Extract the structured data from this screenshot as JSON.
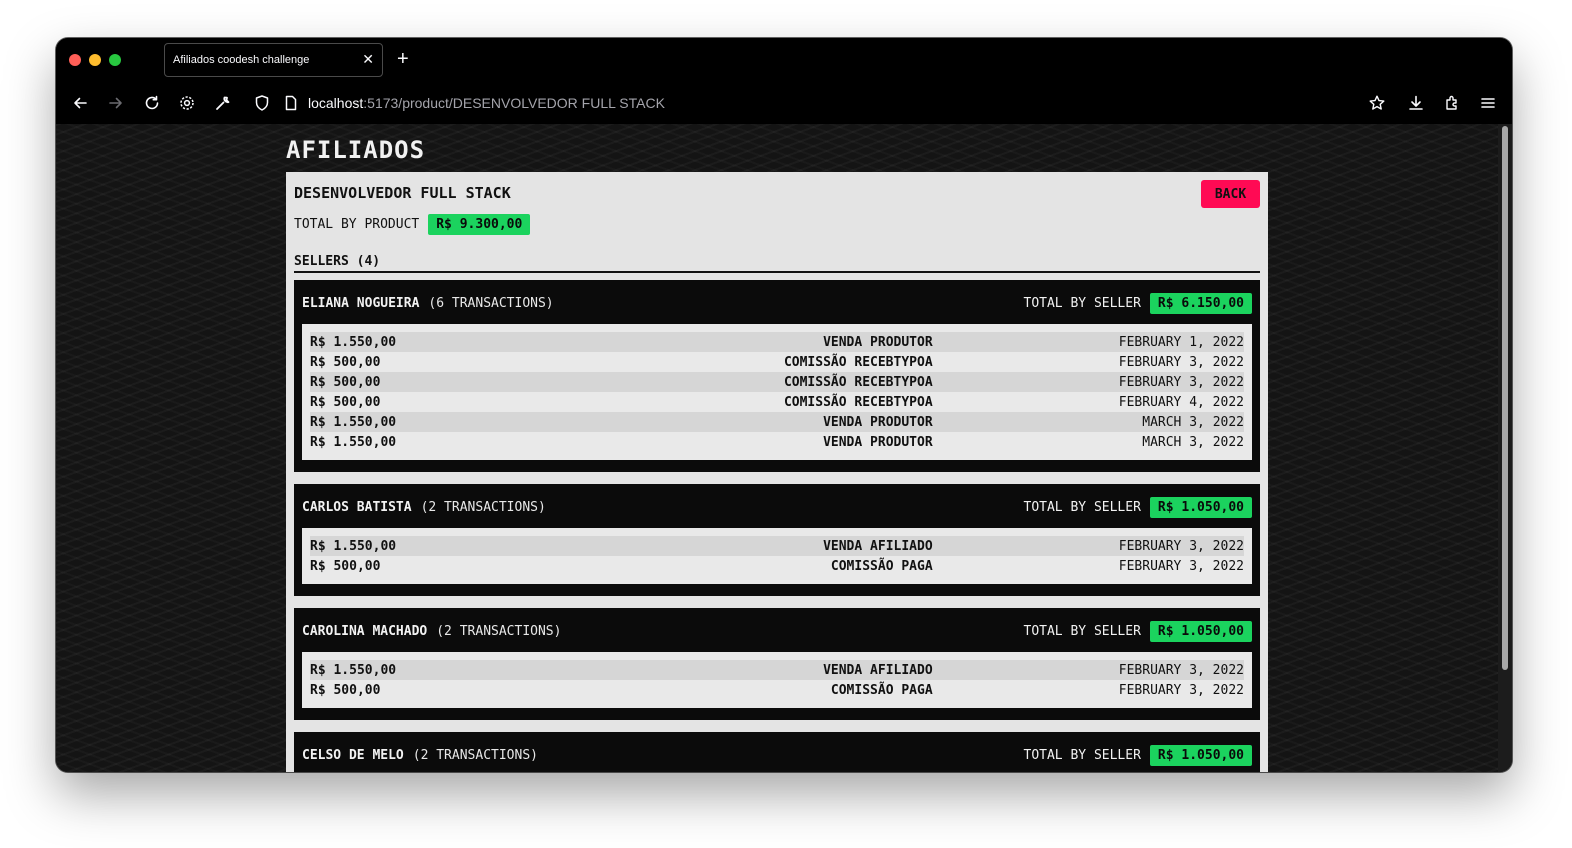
{
  "browser": {
    "tab_title": "Afiliados coodesh challenge",
    "tab_close": "✕",
    "new_tab": "+",
    "url_host": "localhost",
    "url_rest": ":5173/product/DESENVOLVEDOR FULL STACK"
  },
  "page": {
    "title": "AFILIADOS",
    "product_name": "DESENVOLVEDOR FULL STACK",
    "back_label": "BACK",
    "total_by_product_label": "TOTAL BY PRODUCT",
    "total_by_product_value": "R$ 9.300,00",
    "sellers_header": "SELLERS (4)",
    "total_by_seller_label": "TOTAL BY SELLER"
  },
  "sellers": [
    {
      "name": "ELIANA NOGUEIRA",
      "count": "(6 TRANSACTIONS)",
      "total": "R$ 6.150,00",
      "transactions": [
        {
          "value": "R$ 1.550,00",
          "desc": "VENDA PRODUTOR",
          "date": "FEBRUARY 1, 2022"
        },
        {
          "value": "R$ 500,00",
          "desc": "COMISSÃO RECEBTYPOA",
          "date": "FEBRUARY 3, 2022"
        },
        {
          "value": "R$ 500,00",
          "desc": "COMISSÃO RECEBTYPOA",
          "date": "FEBRUARY 3, 2022"
        },
        {
          "value": "R$ 500,00",
          "desc": "COMISSÃO RECEBTYPOA",
          "date": "FEBRUARY 4, 2022"
        },
        {
          "value": "R$ 1.550,00",
          "desc": "VENDA PRODUTOR",
          "date": "MARCH 3, 2022"
        },
        {
          "value": "R$ 1.550,00",
          "desc": "VENDA PRODUTOR",
          "date": "MARCH 3, 2022"
        }
      ]
    },
    {
      "name": "CARLOS BATISTA",
      "count": "(2 TRANSACTIONS)",
      "total": "R$ 1.050,00",
      "transactions": [
        {
          "value": "R$ 1.550,00",
          "desc": "VENDA AFILIADO",
          "date": "FEBRUARY 3, 2022"
        },
        {
          "value": "R$ 500,00",
          "desc": "COMISSÃO PAGA",
          "date": "FEBRUARY 3, 2022"
        }
      ]
    },
    {
      "name": "CAROLINA MACHADO",
      "count": "(2 TRANSACTIONS)",
      "total": "R$ 1.050,00",
      "transactions": [
        {
          "value": "R$ 1.550,00",
          "desc": "VENDA AFILIADO",
          "date": "FEBRUARY 3, 2022"
        },
        {
          "value": "R$ 500,00",
          "desc": "COMISSÃO PAGA",
          "date": "FEBRUARY 3, 2022"
        }
      ]
    },
    {
      "name": "CELSO DE MELO",
      "count": "(2 TRANSACTIONS)",
      "total": "R$ 1.050,00",
      "transactions": []
    }
  ],
  "colors": {
    "accent_green": "#1bd35e",
    "back_red": "#ff0a54",
    "panel_bg": "#e4e4e4",
    "seller_bg": "#0b0b0b"
  },
  "icons": {
    "nav": [
      "back-arrow-icon",
      "forward-arrow-icon",
      "reload-icon",
      "gear-icon",
      "wrench-icon",
      "shield-icon",
      "page-icon"
    ],
    "right": [
      "star-icon",
      "download-icon",
      "extensions-icon",
      "menu-icon"
    ]
  }
}
